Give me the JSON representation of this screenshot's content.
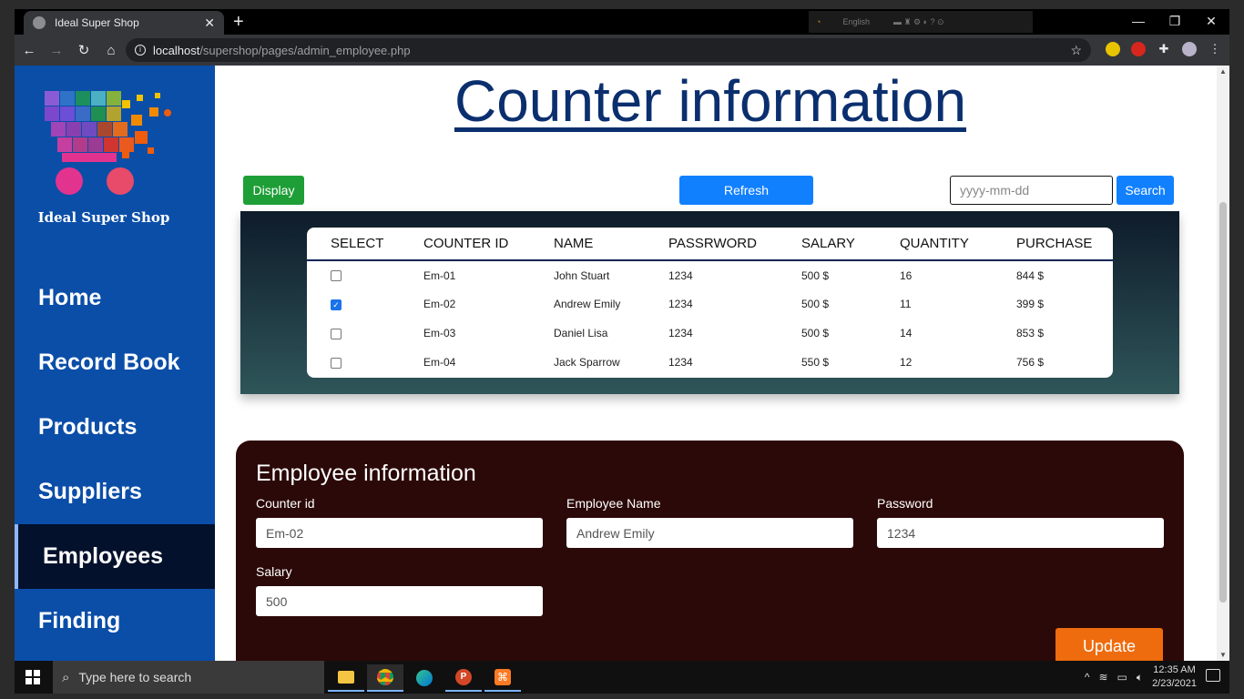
{
  "browser": {
    "tab_title": "Ideal Super Shop",
    "ime_label": "English",
    "url_host": "localhost",
    "url_path": "/supershop/pages/admin_employee.php"
  },
  "sidebar": {
    "logo_text": "Ideal Super Shop",
    "items": [
      {
        "label": "Home"
      },
      {
        "label": "Record Book"
      },
      {
        "label": "Products"
      },
      {
        "label": "Suppliers"
      },
      {
        "label": "Employees",
        "active": true
      },
      {
        "label": "Finding"
      }
    ]
  },
  "main": {
    "title": "Counter information",
    "display_label": "Display",
    "refresh_label": "Refresh",
    "date_placeholder": "yyyy-mm-dd",
    "search_label": "Search"
  },
  "table": {
    "headers": [
      "SELECT",
      "COUNTER ID",
      "NAME",
      "PASSRWORD",
      "SALARY",
      "QUANTITY",
      "PURCHASE"
    ],
    "rows": [
      {
        "checked": false,
        "id": "Em-01",
        "name": "John Stuart",
        "password": "1234",
        "salary": "500 $",
        "quantity": "16",
        "purchase": "844 $"
      },
      {
        "checked": true,
        "id": "Em-02",
        "name": "Andrew Emily",
        "password": "1234",
        "salary": "500 $",
        "quantity": "11",
        "purchase": "399 $"
      },
      {
        "checked": false,
        "id": "Em-03",
        "name": "Daniel Lisa",
        "password": "1234",
        "salary": "500 $",
        "quantity": "14",
        "purchase": "853 $"
      },
      {
        "checked": false,
        "id": "Em-04",
        "name": "Jack Sparrow",
        "password": "1234",
        "salary": "550 $",
        "quantity": "12",
        "purchase": "756 $"
      }
    ]
  },
  "form": {
    "title": "Employee information",
    "counter_id_label": "Counter id",
    "counter_id_value": "Em-02",
    "name_label": "Employee Name",
    "name_value": "Andrew Emily",
    "password_label": "Password",
    "password_value": "1234",
    "salary_label": "Salary",
    "salary_value": "500",
    "update_label": "Update"
  },
  "taskbar": {
    "search_placeholder": "Type here to search",
    "time": "12:35 AM",
    "date": "2/23/2021"
  },
  "colors": {
    "sidebar": "#0b4ea8",
    "active_nav": "#03112c",
    "heading": "#0b2f6e",
    "display": "#1e9e36",
    "primary": "#1180ff",
    "form_bg": "#2b0908",
    "update": "#ee6c0e"
  }
}
